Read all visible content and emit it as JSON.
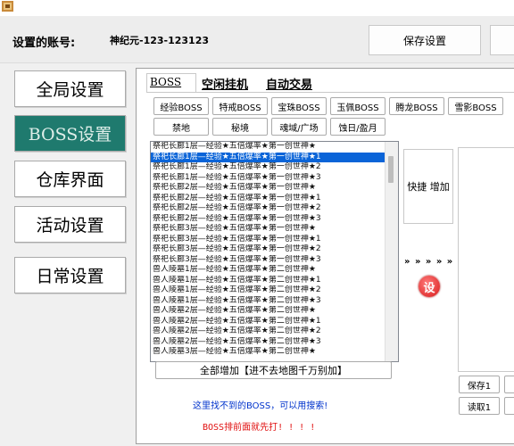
{
  "header": {
    "account_label": "设置的账号:",
    "account_value": "神纪元-123-123123",
    "save_settings": "保存设置"
  },
  "nav": {
    "items": [
      {
        "label": "全局设置",
        "active": false
      },
      {
        "label": "BOSS设置",
        "active": true
      },
      {
        "label": "仓库界面",
        "active": false
      },
      {
        "label": "活动设置",
        "active": false
      },
      {
        "label": "日常设置",
        "active": false
      }
    ]
  },
  "tabs": [
    "BOSS",
    "空闲挂机",
    "自动交易"
  ],
  "category_buttons": {
    "row1": [
      "经验BOSS",
      "特戒BOSS",
      "宝珠BOSS",
      "玉佩BOSS",
      "腾龙BOSS",
      "雪影BOSS"
    ],
    "row2": [
      "禁地",
      "秘境",
      "魂域/广场",
      "蚀日/盈月"
    ]
  },
  "boss_list": {
    "selected_index": 1,
    "items": [
      "祭祀长廊1层—经验★五倍爆率★第一创世神★",
      "祭祀长廊1层—经验★五倍爆率★第一创世神★1",
      "祭祀长廊1层—经验★五倍爆率★第一创世神★2",
      "祭祀长廊1层—经验★五倍爆率★第一创世神★3",
      "祭祀长廊2层—经验★五倍爆率★第一创世神★",
      "祭祀长廊2层—经验★五倍爆率★第一创世神★1",
      "祭祀长廊2层—经验★五倍爆率★第一创世神★2",
      "祭祀长廊2层—经验★五倍爆率★第一创世神★3",
      "祭祀长廊3层—经验★五倍爆率★第一创世神★",
      "祭祀长廊3层—经验★五倍爆率★第一创世神★1",
      "祭祀长廊3层—经验★五倍爆率★第一创世神★2",
      "祭祀长廊3层—经验★五倍爆率★第一创世神★3",
      "兽人陵墓1层—经验★五倍爆率★第二创世神★",
      "兽人陵墓1层—经验★五倍爆率★第二创世神★1",
      "兽人陵墓1层—经验★五倍爆率★第二创世神★2",
      "兽人陵墓1层—经验★五倍爆率★第二创世神★3",
      "兽人陵墓2层—经验★五倍爆率★第二创世神★",
      "兽人陵墓2层—经验★五倍爆率★第二创世神★1",
      "兽人陵墓2层—经验★五倍爆率★第二创世神★2",
      "兽人陵墓2层—经验★五倍爆率★第二创世神★3",
      "兽人陵墓3层—经验★五倍爆率★第二创世神★"
    ]
  },
  "add_all": "全部增加【进不去地图千万别加】",
  "hint_not_found": "这里找不到的BOSS，可以用搜索!",
  "hint_priority": "BOSS排前面就先打! ! ! !",
  "quick_add": "快捷 增加",
  "arrows": "» » » » »",
  "settings_icon_glyph": "设",
  "save1": "保存1",
  "read1": "读取1",
  "colors": {
    "active_nav": "#1f7a6e",
    "selection": "#0a64d8",
    "hint_blue": "#0033cc",
    "hint_red": "#e01010"
  }
}
